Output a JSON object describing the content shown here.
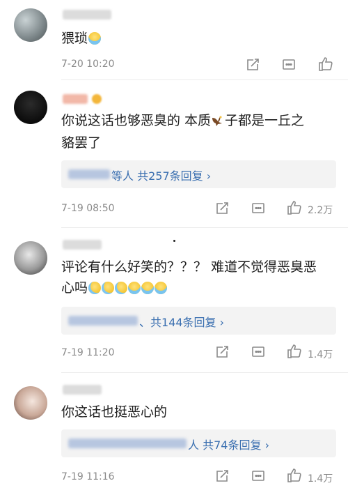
{
  "comments": [
    {
      "text": "猥琐",
      "emoji": "cry",
      "time": "7-20 10:20",
      "likes": ""
    },
    {
      "text_line1_a": "你说这话也够恶臭的 本质",
      "text_line1_b": "子都是一丘之",
      "text_line2": "貉罢了",
      "reply_suffix": "等人",
      "reply_count_label": "共257条回复",
      "time": "7-19 08:50",
      "likes": "2.2万"
    },
    {
      "text_line1": "评论有什么好笑的？？？ 难道不觉得恶臭恶",
      "text_line2": "心吗",
      "emojis": [
        "sweat",
        "sweat",
        "sweat",
        "cry",
        "cry",
        "cry"
      ],
      "reply_suffix": "、",
      "reply_count_label": "共144条回复",
      "time": "7-19 11:20",
      "likes": "1.4万"
    },
    {
      "text": "你这话也挺恶心的",
      "reply_suffix": "人",
      "reply_count_label": "共74条回复",
      "time": "7-19 11:16",
      "likes": "1.4万"
    }
  ],
  "icons": [
    "share-icon",
    "comment-icon",
    "like-icon",
    "eagle-emoji",
    "crying-emoji",
    "sweat-emoji",
    "chevron-right-icon"
  ],
  "colors": {
    "link": "#3a6fb0",
    "meta": "#8a8a8a",
    "reply_bg": "#f3f3f3"
  }
}
